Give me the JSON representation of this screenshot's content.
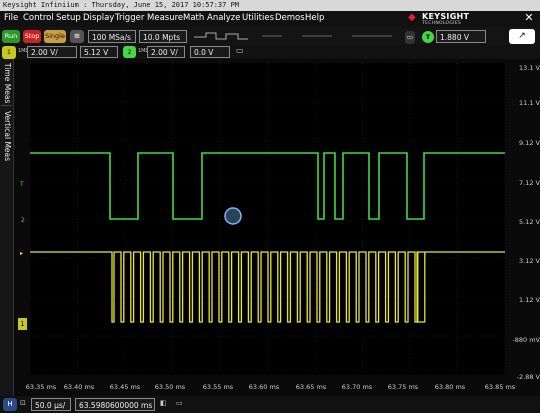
{
  "window": {
    "title": "Keysight Infiniium : Thursday, June 15, 2017 10:57:37 PM"
  },
  "menu": [
    "File",
    "Control",
    "Setup",
    "Display",
    "Trigger",
    "Measure",
    "Math",
    "Analyze",
    "Utilities",
    "Demos",
    "Help"
  ],
  "logo": {
    "brand": "KEYSIGHT",
    "sub": "TECHNOLOGIES"
  },
  "acquisition": {
    "run_label": "Run",
    "stop_label": "Stop",
    "single_label": "Single",
    "sample_rate": "100 MSa/s",
    "memory_depth": "10.0 Mpts"
  },
  "trigger": {
    "badge": "T",
    "level": "1.880 V"
  },
  "channels": [
    {
      "badge": "1",
      "scale": "2.00 V/",
      "offset": "5.12 V",
      "color": "#e8e832"
    },
    {
      "badge": "2",
      "scale": "2.00 V/",
      "offset": "0.0 V",
      "color": "#44d844"
    }
  ],
  "side_tabs": [
    "Time Meas",
    "Vertical Meas"
  ],
  "y_axis_labels": [
    "13.1 V",
    "11.1 V",
    "9.12 V",
    "7.12 V",
    "5.12 V",
    "3.12 V",
    "1.12 V",
    "-880 mV",
    "-2.88 V"
  ],
  "x_axis_labels": [
    "63.35 ms",
    "63.40 ms",
    "63.45 ms",
    "63.50 ms",
    "63.55 ms",
    "63.60 ms",
    "63.65 ms",
    "63.70 ms",
    "63.75 ms",
    "63.80 ms",
    "63.85 ms"
  ],
  "timebase": {
    "scale": "50.0 µs/",
    "position": "63.5980600000 ms"
  },
  "colors": {
    "ch1": "#e8e832",
    "ch2": "#44d844",
    "grid": "#2a2a2a"
  }
}
